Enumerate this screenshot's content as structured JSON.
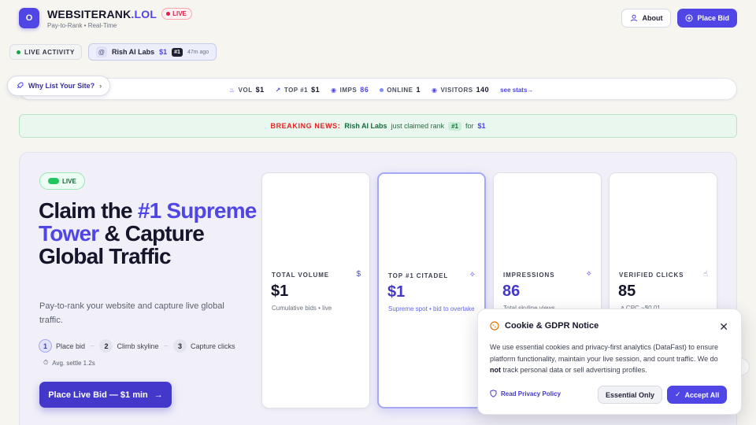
{
  "header": {
    "logo_letter": "O",
    "brand_name": "WEBSITERANK",
    "brand_tld": ".LOL",
    "live_label": "LIVE",
    "subtitle": "Pay-to-Rank • Real-Time",
    "about_label": "About",
    "bid_label": "Place Bid"
  },
  "activity": {
    "chip_label": "LIVE ACTIVITY",
    "entry": {
      "icon": "@",
      "name": "Rish AI Labs",
      "amount": "$1",
      "rank": "#1",
      "time": "47m ago"
    }
  },
  "statsbar": {
    "why_label": "Why List Your Site?",
    "stats": [
      {
        "label": "VOL",
        "value": "$1"
      },
      {
        "label": "TOP #1",
        "value": "$1"
      },
      {
        "label": "IMPS",
        "value": "86"
      },
      {
        "label": "ONLINE",
        "value": "1"
      },
      {
        "label": "VISITORS",
        "value": "140"
      }
    ],
    "link": "see stats→"
  },
  "breaking": {
    "label": "BREAKING NEWS:",
    "name": "Rish AI Labs",
    "text1": "just claimed rank",
    "rank": "#1",
    "text2": "for",
    "amount": "$1"
  },
  "hero": {
    "live_label": "LIVE",
    "title_1": "Claim the ",
    "title_accent": "#1 Supreme Tower",
    "title_2": " & Capture Global Traffic",
    "description": "Pay-to-rank your website and capture live global traffic.",
    "steps": [
      {
        "num": "1",
        "label": "Place bid"
      },
      {
        "num": "2",
        "label": "Climb skyline"
      },
      {
        "num": "3",
        "label": "Capture clicks"
      }
    ],
    "settle": "Avg. settle 1.2s",
    "cta": "Place Live Bid — $1 min"
  },
  "cards": [
    {
      "label": "TOTAL VOLUME",
      "value": "$1",
      "sub": "Cumulative bids • live"
    },
    {
      "label": "TOP #1 CITADEL",
      "value": "$1",
      "sub": "Supreme spot • bid to overtake"
    },
    {
      "label": "IMPRESSIONS",
      "value": "86",
      "sub": "Total skyline views"
    },
    {
      "label": "VERIFIED CLICKS",
      "value": "85",
      "sub": "↗ CPC ~$0.01"
    }
  ],
  "cookie": {
    "title": "Cookie & GDPR Notice",
    "body_1": "We use essential cookies and privacy-first analytics (DataFast) to ensure platform functionality, maintain your live session, and count traffic. We do ",
    "body_bold": "not",
    "body_2": " track personal data or sell advertising profiles.",
    "policy_link": "Read Privacy Policy",
    "essential_label": "Essential Only",
    "accept_label": "Accept All"
  },
  "colors": {
    "accent": "#4f46e5",
    "live_red": "#e11d48",
    "live_green": "#22c55e",
    "breaking_red": "#dc2626"
  }
}
